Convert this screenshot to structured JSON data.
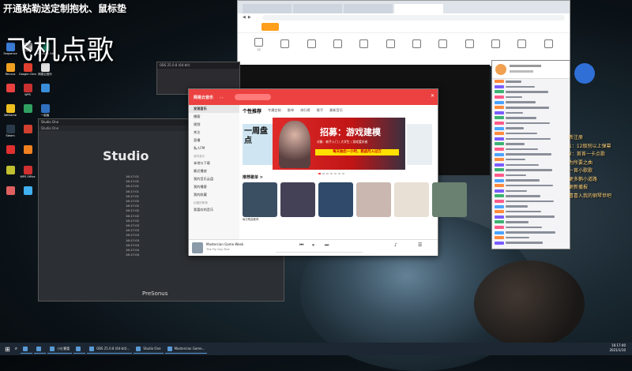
{
  "overlay": {
    "banner": "开通粘勒送定制抱枕、鼠标垫",
    "title": "飞机点歌"
  },
  "desktop_icons": [
    {
      "label": "Sequence",
      "color": "#3a7bd5"
    },
    {
      "label": "",
      "color": "#d0d0d0"
    },
    {
      "label": "Microsoft Edge",
      "color": "#1f8f6f"
    },
    {
      "label": "Recuva",
      "color": "#f0a020"
    },
    {
      "label": "Google Chrome",
      "color": "#e04030"
    },
    {
      "label": "网易云音乐",
      "color": "#e0e0e0"
    },
    {
      "label": "",
      "color": "#e94040"
    },
    {
      "label": "WPS",
      "color": "#c83030"
    },
    {
      "label": "",
      "color": "#3a8dd8"
    },
    {
      "label": "WeGame",
      "color": "#f0c020"
    },
    {
      "label": "",
      "color": "#30a060"
    },
    {
      "label": "一起画",
      "color": "#3070c0"
    },
    {
      "label": "Steam",
      "color": "#2a3a4a"
    },
    {
      "label": "",
      "color": "#d04030"
    },
    {
      "label": "",
      "color": "#5050d0"
    },
    {
      "label": "",
      "color": "#e03030"
    },
    {
      "label": "",
      "color": "#f08020"
    },
    {
      "label": "",
      "color": "#20a0d0"
    },
    {
      "label": "",
      "color": "#c0c030"
    },
    {
      "label": "WPS Office",
      "color": "#d03030"
    },
    {
      "label": "",
      "color": "#3060c0"
    },
    {
      "label": "",
      "color": "#e06060"
    },
    {
      "label": "",
      "color": "#40b0f0"
    },
    {
      "label": "",
      "color": "#f0d020"
    }
  ],
  "browser": {
    "tabs": [
      "",
      "",
      "",
      ""
    ],
    "url": "",
    "site_nav": [
      "",
      "",
      "",
      "",
      "",
      ""
    ],
    "categories": [
      "12",
      "",
      "",
      "",
      "",
      "",
      "",
      "",
      "",
      "",
      "",
      ""
    ]
  },
  "obs": {
    "title": "OBS 25.0.8 (64-bit)"
  },
  "studio_one": {
    "title": "Studio One",
    "menu": "Studio One",
    "logo": "Studio",
    "presonus": "PreSonus",
    "log": [
      "16:17:01",
      "16:17:01",
      "16:17:01",
      "16:17:01",
      "16:17:01",
      "16:17:02",
      "16:17:02",
      "16:17:02",
      "16:17:02",
      "16:17:02",
      "16:17:03",
      "16:17:03",
      "16:17:03",
      "16:17:03",
      "16:17:04",
      "16:17:04",
      "16:17:04"
    ]
  },
  "music": {
    "app_name": "网易云音乐",
    "user": "",
    "sidebar": [
      "发现音乐",
      "播客",
      "视频",
      "关注",
      "直播",
      "私人FM"
    ],
    "sidebar_section": "我的音乐",
    "sidebar_mine": [
      "本地与下载",
      "最近播放",
      "我的音乐云盘",
      "我的播客",
      "我的收藏"
    ],
    "sidebar_section2": "创建的歌单",
    "sidebar_more": [
      "我喜欢的音乐"
    ],
    "tabs": [
      "个性推荐",
      "专属定制",
      "歌单",
      "排行榜",
      "歌手",
      "最新音乐"
    ],
    "banner_left": "一周盘点",
    "banner_headline": "招募：游戏建模",
    "banner_sub": "对象：新手入门 / 大学生 / 游戏爱好者",
    "banner_yellow": "每天抽出一小时，挑战月入过万",
    "section_title": "推荐歌单 >",
    "playlists": [
      {
        "caption": "每日歌曲推荐",
        "color": "#3b4f63"
      },
      {
        "caption": "",
        "color": "#444055"
      },
      {
        "caption": "",
        "color": "#2f4a6a"
      },
      {
        "caption": "",
        "color": "#c9b7b0"
      },
      {
        "caption": "",
        "color": "#e8e0d5"
      },
      {
        "caption": "",
        "color": "#6a8070"
      }
    ],
    "player": {
      "song": "Mastercian Game Week",
      "artist": "The Fly Guy Five"
    }
  },
  "chat": {
    "gift_label": "",
    "overlay_lines": [
      "新注册",
      "1：12级别以上弹幕",
      "2：首首一卡点歌",
      "为所要之曲",
      "一首小歌歌",
      "更多鹅小道路",
      "更新播报",
      "喜喜入我的钢琴世吧"
    ]
  },
  "taskbar": {
    "items": [
      "",
      "",
      "小红薯蕾",
      "",
      "OBS 25.0.8 (64-bit)...",
      "Studio One",
      "Mastercian Game..."
    ],
    "time": "16:17:40",
    "date": "2021/1/10"
  }
}
